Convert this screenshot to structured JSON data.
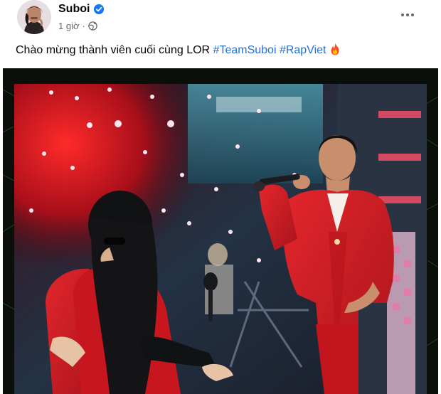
{
  "post": {
    "author": "Suboi",
    "time": "1 giờ",
    "separator": "·",
    "text_before": "Chào mừng thành viên cuối cùng LOR",
    "hashtags": [
      "#TeamSuboi",
      "#RapViet"
    ],
    "emoji": "🔥"
  },
  "icons": {
    "verified": "verified-badge-icon",
    "audience": "globe-icon",
    "menu": "more-options-icon"
  },
  "colors": {
    "verified": "#1877f2",
    "hashtag": "#216fdb",
    "secondary_text": "#65676b",
    "suit_red": "#d41b22"
  }
}
